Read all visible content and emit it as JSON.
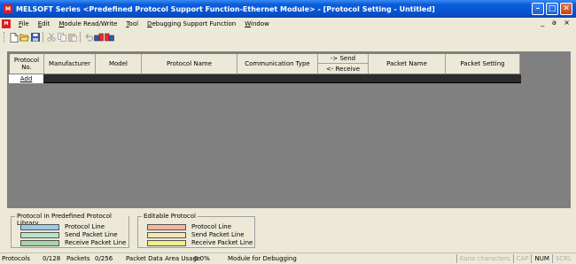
{
  "window": {
    "app_icon": "MELSOFT",
    "title": "MELSOFT Series <Predefined Protocol Support Function-Ethernet Module> - [Protocol Setting - Untitled]",
    "controls": [
      "minimize",
      "maximize",
      "close"
    ]
  },
  "menubar": {
    "doc_icon": "MELSOFT",
    "items": [
      "File",
      "Edit",
      "Module Read/Write",
      "Tool",
      "Debugging Support Function",
      "Window"
    ],
    "mdi_controls": "_ ɐ ×"
  },
  "toolbar": {
    "icons": [
      "new-icon",
      "open-icon",
      "save-icon",
      "cut-icon",
      "copy-icon",
      "paste-icon",
      "undo-icon",
      "write-icon",
      "read-icon"
    ]
  },
  "grid": {
    "columns": {
      "protocol_no": "Protocol No.",
      "manufacturer": "Manufacturer",
      "model": "Model",
      "protocol_name": "Protocol Name",
      "communication_type": "Communication Type",
      "send": "-> Send",
      "receive": "<- Receive",
      "packet_name": "Packet Name",
      "packet_setting": "Packet Setting"
    },
    "add_label": "Add"
  },
  "legend": {
    "library": {
      "title": "Protocol in Predefined Protocol Library",
      "rows": [
        {
          "label": "Protocol Line",
          "color": "#9cc9e8"
        },
        {
          "label": "Send Packet Line",
          "color": "#b9e3c8"
        },
        {
          "label": "Receive Packet Line",
          "color": "#a7d6a7"
        }
      ]
    },
    "editable": {
      "title": "Editable Protocol",
      "rows": [
        {
          "label": "Protocol Line",
          "color": "#f6b59c"
        },
        {
          "label": "Send Packet Line",
          "color": "#f3e7b4"
        },
        {
          "label": "Receive Packet Line",
          "color": "#f0ee8a"
        }
      ]
    }
  },
  "statusbar": {
    "protocols": "Protocols",
    "protocols_count": "0/128",
    "packets": "Packets",
    "packets_count": "0/256",
    "usage": "Packet Data Area Usage",
    "usage_value": "0.0%",
    "module": "Module for Debugging",
    "kana": "Kana characters",
    "cap": "CAP",
    "num": "NUM",
    "scrl": "SCRL"
  }
}
